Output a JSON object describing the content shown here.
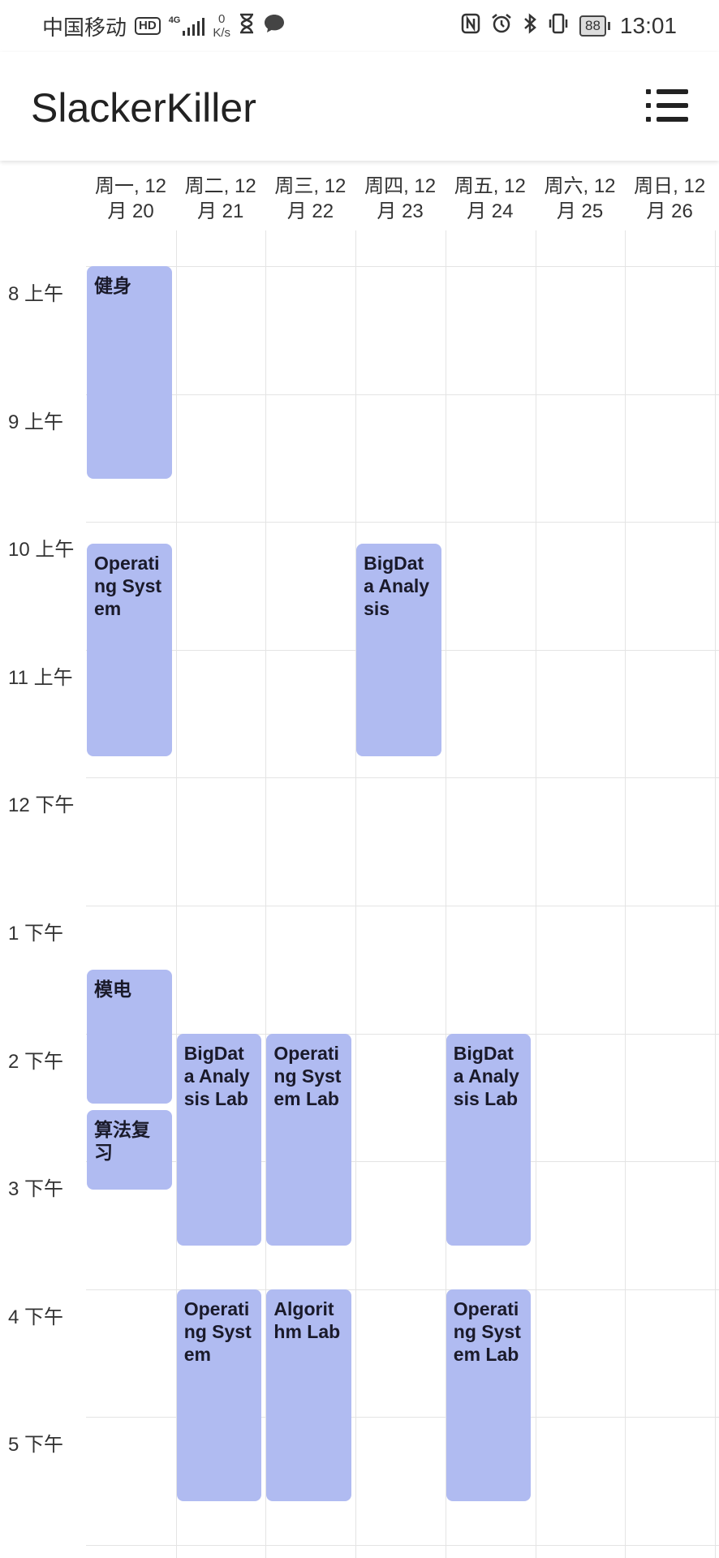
{
  "status_bar": {
    "carrier": "中国移动",
    "hd_badge": "HD",
    "network_type": "4G",
    "net_speed_value": "0",
    "net_speed_unit": "K/s",
    "battery": "88",
    "time": "13:01",
    "icons": [
      "hd-icon",
      "signal-icon",
      "hourglass-icon",
      "message-icon",
      "nfc-icon",
      "alarm-icon",
      "bluetooth-icon",
      "vibrate-icon",
      "battery-icon"
    ]
  },
  "app_bar": {
    "title": "SlackerKiller",
    "menu_icon": "list-menu-icon"
  },
  "calendar": {
    "days": [
      {
        "label": "周一, 12 月 20"
      },
      {
        "label": "周二, 12 月 21"
      },
      {
        "label": "周三, 12 月 22"
      },
      {
        "label": "周四, 12 月 23"
      },
      {
        "label": "周五, 12 月 24"
      },
      {
        "label": "周六, 12 月 25"
      },
      {
        "label": "周日, 12 月 26"
      }
    ],
    "hours": [
      {
        "label": "8 上午",
        "hour": 8
      },
      {
        "label": "9 上午",
        "hour": 9
      },
      {
        "label": "10 上午",
        "hour": 10
      },
      {
        "label": "11 上午",
        "hour": 11
      },
      {
        "label": "12 下午",
        "hour": 12
      },
      {
        "label": "1 下午",
        "hour": 13
      },
      {
        "label": "2 下午",
        "hour": 14
      },
      {
        "label": "3 下午",
        "hour": 15
      },
      {
        "label": "4 下午",
        "hour": 16
      },
      {
        "label": "5 下午",
        "hour": 17
      }
    ],
    "event_color": "#b0bbf1",
    "events": [
      {
        "title": "健身",
        "day": 0,
        "start": 8.0,
        "end": 9.66
      },
      {
        "title": "Operating System",
        "day": 0,
        "start": 10.17,
        "end": 11.83
      },
      {
        "title": "模电",
        "day": 0,
        "start": 13.5,
        "end": 14.55
      },
      {
        "title": "算法复习",
        "day": 0,
        "start": 14.6,
        "end": 15.22
      },
      {
        "title": "BigData Analysis Lab",
        "day": 1,
        "start": 14.0,
        "end": 15.66
      },
      {
        "title": "Operating System",
        "day": 1,
        "start": 16.0,
        "end": 17.66
      },
      {
        "title": "Operating System Lab",
        "day": 2,
        "start": 14.0,
        "end": 15.66
      },
      {
        "title": "Algorithm Lab",
        "day": 2,
        "start": 16.0,
        "end": 17.66
      },
      {
        "title": "BigData Analysis",
        "day": 3,
        "start": 10.17,
        "end": 11.83
      },
      {
        "title": "BigData Analysis Lab",
        "day": 4,
        "start": 14.0,
        "end": 15.66
      },
      {
        "title": "Operating System Lab",
        "day": 4,
        "start": 16.0,
        "end": 17.66
      }
    ]
  }
}
